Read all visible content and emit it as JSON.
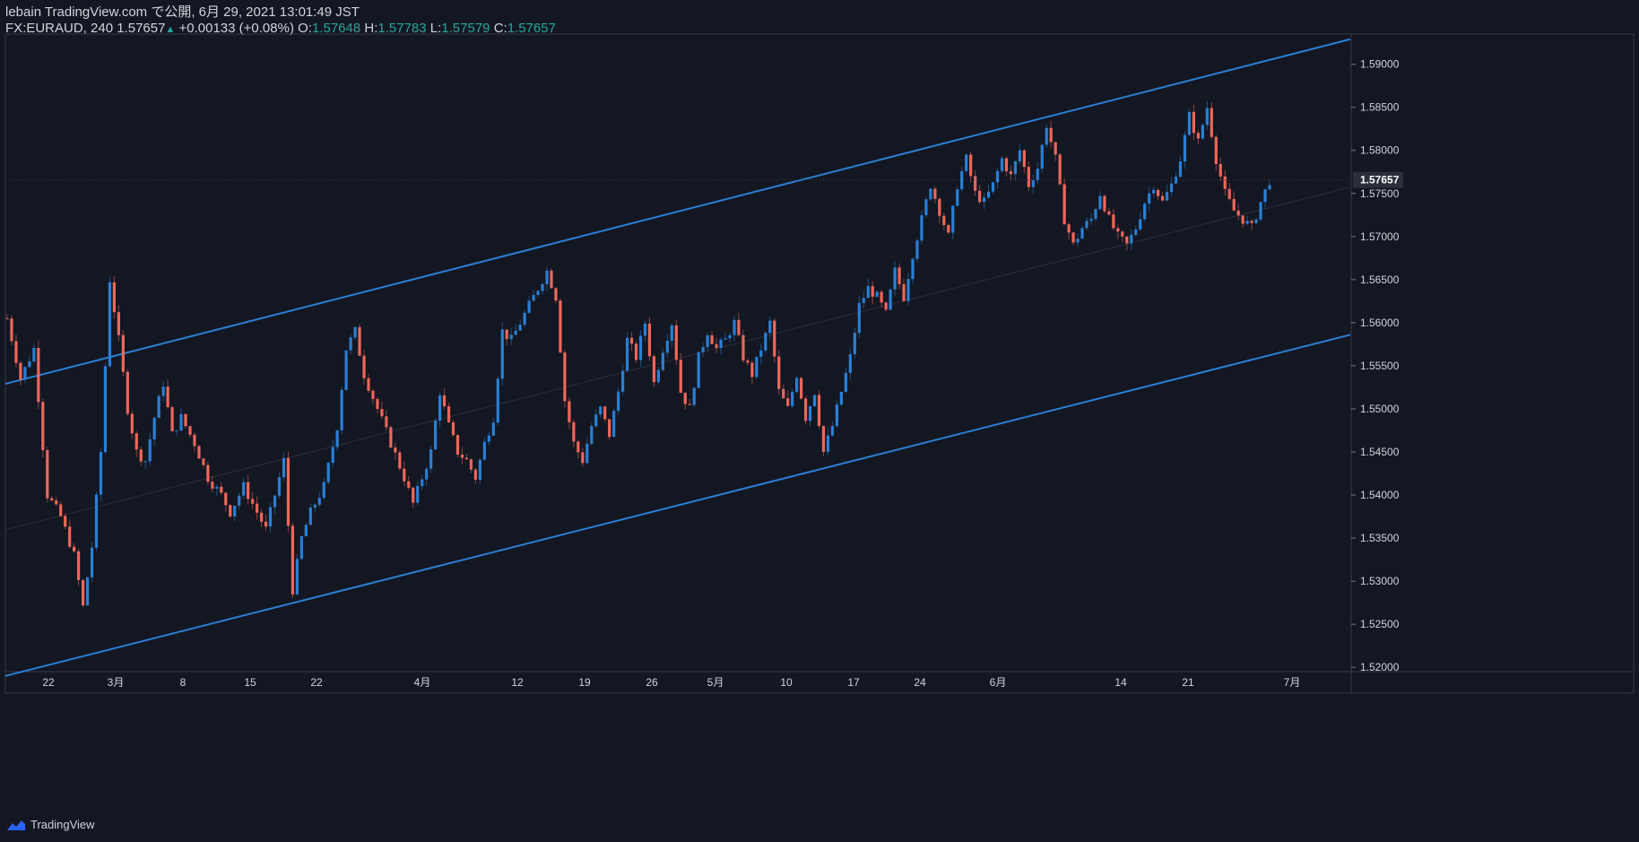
{
  "header": {
    "line1": "lebain TradingView.com で公開, 6月 29, 2021 13:01:49 JST",
    "symbol": "FX:EURAUD, 240",
    "last": "1.57657",
    "change": "+0.00133 (+0.08%)",
    "o_label": "O:",
    "o_val": "1.57648",
    "h_label": "H:",
    "h_val": "1.57783",
    "l_label": "L:",
    "l_val": "1.57579",
    "c_label": "C:",
    "c_val": "1.57657"
  },
  "footer": {
    "brand": "TradingView"
  },
  "colors": {
    "background": "#131722",
    "up_candle": "#2a7fd4",
    "down_candle": "#f0675a",
    "channel": "#2a7fd4",
    "axis_text": "#d1d4dc",
    "price_badge_bg": "#2a2e39"
  },
  "chart_data": {
    "type": "candlestick",
    "ylim": [
      1.5195,
      1.5935
    ],
    "y_ticks": [
      "1.52000",
      "1.52500",
      "1.53000",
      "1.53500",
      "1.54000",
      "1.54500",
      "1.55000",
      "1.55500",
      "1.56000",
      "1.56500",
      "1.57000",
      "1.57500",
      "1.58000",
      "1.58500",
      "1.59000"
    ],
    "x_ticks": [
      "22",
      "3月",
      "8",
      "15",
      "22",
      "4月",
      "12",
      "19",
      "26",
      "5月",
      "10",
      "17",
      "24",
      "6月",
      "14",
      "21",
      "7月"
    ],
    "last_price": "1.57657",
    "close_path": [
      [
        0,
        1.5605
      ],
      [
        3,
        1.5535
      ],
      [
        6,
        1.557
      ],
      [
        9,
        1.54
      ],
      [
        12,
        1.5375
      ],
      [
        15,
        1.533
      ],
      [
        17,
        1.527
      ],
      [
        19,
        1.534
      ],
      [
        21,
        1.545
      ],
      [
        23,
        1.565
      ],
      [
        25,
        1.558
      ],
      [
        27,
        1.55
      ],
      [
        29,
        1.545
      ],
      [
        31,
        1.544
      ],
      [
        33,
        1.549
      ],
      [
        35,
        1.553
      ],
      [
        37,
        1.547
      ],
      [
        39,
        1.549
      ],
      [
        42,
        1.546
      ],
      [
        45,
        1.542
      ],
      [
        48,
        1.54
      ],
      [
        50,
        1.538
      ],
      [
        53,
        1.541
      ],
      [
        55,
        1.539
      ],
      [
        58,
        1.536
      ],
      [
        60,
        1.54
      ],
      [
        62,
        1.544
      ],
      [
        64,
        1.529
      ],
      [
        66,
        1.535
      ],
      [
        68,
        1.538
      ],
      [
        71,
        1.541
      ],
      [
        74,
        1.548
      ],
      [
        76,
        1.557
      ],
      [
        78,
        1.559
      ],
      [
        80,
        1.554
      ],
      [
        83,
        1.55
      ],
      [
        86,
        1.546
      ],
      [
        89,
        1.542
      ],
      [
        91,
        1.539
      ],
      [
        93,
        1.542
      ],
      [
        95,
        1.545
      ],
      [
        97,
        1.552
      ],
      [
        99,
        1.548
      ],
      [
        101,
        1.545
      ],
      [
        103,
        1.544
      ],
      [
        105,
        1.542
      ],
      [
        107,
        1.546
      ],
      [
        109,
        1.549
      ],
      [
        111,
        1.559
      ],
      [
        113,
        1.558
      ],
      [
        115,
        1.56
      ],
      [
        117,
        1.562
      ],
      [
        119,
        1.564
      ],
      [
        121,
        1.566
      ],
      [
        123,
        1.563
      ],
      [
        125,
        1.551
      ],
      [
        127,
        1.546
      ],
      [
        129,
        1.544
      ],
      [
        131,
        1.548
      ],
      [
        133,
        1.55
      ],
      [
        135,
        1.547
      ],
      [
        137,
        1.552
      ],
      [
        139,
        1.558
      ],
      [
        141,
        1.556
      ],
      [
        143,
        1.56
      ],
      [
        145,
        1.553
      ],
      [
        147,
        1.557
      ],
      [
        149,
        1.56
      ],
      [
        151,
        1.552
      ],
      [
        153,
        1.55
      ],
      [
        155,
        1.556
      ],
      [
        157,
        1.559
      ],
      [
        159,
        1.557
      ],
      [
        161,
        1.558
      ],
      [
        163,
        1.56
      ],
      [
        165,
        1.556
      ],
      [
        167,
        1.554
      ],
      [
        169,
        1.557
      ],
      [
        171,
        1.56
      ],
      [
        173,
        1.552
      ],
      [
        175,
        1.55
      ],
      [
        177,
        1.554
      ],
      [
        179,
        1.549
      ],
      [
        181,
        1.552
      ],
      [
        183,
        1.545
      ],
      [
        185,
        1.548
      ],
      [
        187,
        1.552
      ],
      [
        189,
        1.556
      ],
      [
        191,
        1.562
      ],
      [
        193,
        1.564
      ],
      [
        195,
        1.563
      ],
      [
        197,
        1.561
      ],
      [
        199,
        1.566
      ],
      [
        201,
        1.563
      ],
      [
        203,
        1.568
      ],
      [
        205,
        1.572
      ],
      [
        207,
        1.576
      ],
      [
        209,
        1.573
      ],
      [
        211,
        1.57
      ],
      [
        213,
        1.576
      ],
      [
        215,
        1.579
      ],
      [
        217,
        1.575
      ],
      [
        219,
        1.574
      ],
      [
        221,
        1.576
      ],
      [
        223,
        1.579
      ],
      [
        225,
        1.577
      ],
      [
        227,
        1.58
      ],
      [
        229,
        1.576
      ],
      [
        231,
        1.578
      ],
      [
        233,
        1.583
      ],
      [
        235,
        1.579
      ],
      [
        237,
        1.572
      ],
      [
        239,
        1.569
      ],
      [
        241,
        1.571
      ],
      [
        243,
        1.572
      ],
      [
        245,
        1.575
      ],
      [
        247,
        1.572
      ],
      [
        249,
        1.57
      ],
      [
        251,
        1.569
      ],
      [
        253,
        1.571
      ],
      [
        255,
        1.574
      ],
      [
        257,
        1.576
      ],
      [
        259,
        1.574
      ],
      [
        261,
        1.576
      ],
      [
        263,
        1.579
      ],
      [
        265,
        1.584
      ],
      [
        267,
        1.581
      ],
      [
        269,
        1.585
      ],
      [
        271,
        1.579
      ],
      [
        273,
        1.575
      ],
      [
        275,
        1.573
      ],
      [
        277,
        1.572
      ],
      [
        279,
        1.571
      ],
      [
        281,
        1.574
      ],
      [
        283,
        1.5765
      ]
    ],
    "channel_lines": [
      {
        "name": "upper",
        "from": [
          0,
          1.5529
        ],
        "to": [
          1.0,
          1.5929
        ]
      },
      {
        "name": "lower",
        "from": [
          0,
          1.519
        ],
        "to": [
          1.0,
          1.5586
        ]
      }
    ]
  }
}
